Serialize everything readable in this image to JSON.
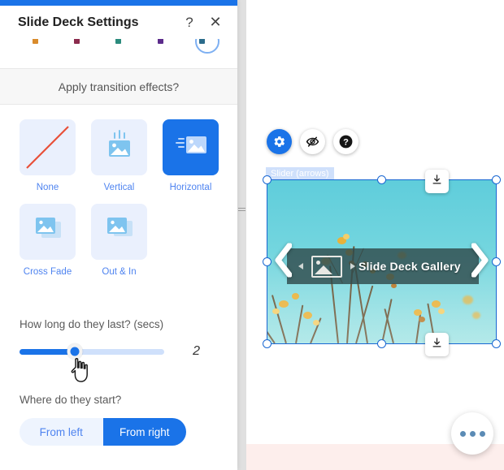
{
  "panel": {
    "title": "Slide Deck Settings",
    "help_icon": "?",
    "close_icon": "✕",
    "section_header": "Apply transition effects?",
    "transitions": [
      {
        "label": "None",
        "icon": "no-transition-icon",
        "selected": false
      },
      {
        "label": "Vertical",
        "icon": "vertical-transition-icon",
        "selected": false
      },
      {
        "label": "Horizontal",
        "icon": "horizontal-transition-icon",
        "selected": true
      },
      {
        "label": "Cross Fade",
        "icon": "cross-fade-icon",
        "selected": false
      },
      {
        "label": "Out & In",
        "icon": "out-and-in-icon",
        "selected": false
      }
    ],
    "duration": {
      "label": "How long do they last? (secs)",
      "value": "2",
      "min": 0,
      "max": 10,
      "percent": 38
    },
    "direction": {
      "label": "Where do they start?",
      "options": [
        {
          "label": "From left",
          "active": false
        },
        {
          "label": "From right",
          "active": true
        }
      ]
    }
  },
  "canvas": {
    "tools": [
      {
        "name": "settings-gear-icon",
        "active": true
      },
      {
        "name": "hide-eye-icon",
        "active": false
      },
      {
        "name": "help-question-icon",
        "active": false
      }
    ],
    "element_label": "Slider (arrows)",
    "slide": {
      "caption": "Slide Deck Gallery",
      "prev_icon": "chevron-left-icon",
      "next_icon": "chevron-right-icon",
      "thumb_icon": "image-placeholder-icon"
    },
    "download_icon": "download-icon",
    "more_button": "more-options-button",
    "footer_text": ""
  },
  "colors": {
    "accent": "#1a73e8",
    "tile_bg": "#eaf0fd",
    "tile_text": "#4f84f0",
    "selection": "#1967d2",
    "panel_header_bg": "#f7f7f7",
    "pink_band": "#fdeeec"
  }
}
